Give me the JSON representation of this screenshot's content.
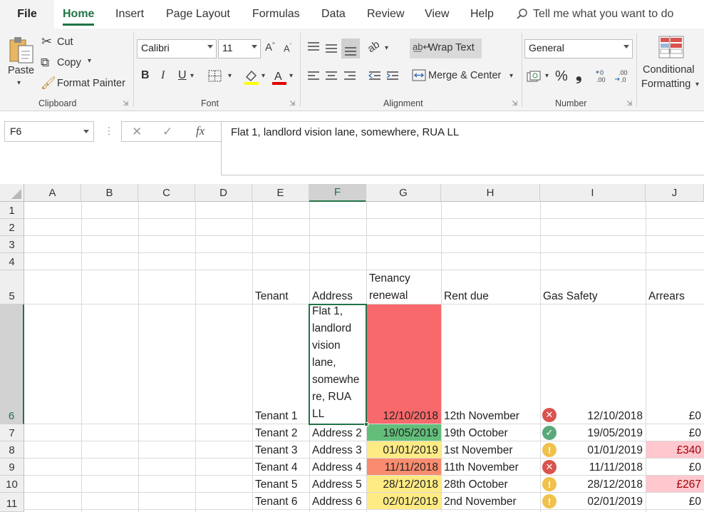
{
  "tabs": {
    "file": "File",
    "items": [
      "Home",
      "Insert",
      "Page Layout",
      "Formulas",
      "Data",
      "Review",
      "View",
      "Help"
    ],
    "tell_me": "Tell me what you want to do"
  },
  "ribbon": {
    "clipboard": {
      "paste": "Paste",
      "cut": "Cut",
      "copy": "Copy",
      "format_painter": "Format Painter",
      "label": "Clipboard"
    },
    "font": {
      "name": "Calibri",
      "size": "11",
      "bold": "B",
      "italic": "I",
      "underline": "U",
      "label": "Font"
    },
    "alignment": {
      "wrap_text": "Wrap Text",
      "merge_center": "Merge & Center",
      "label": "Alignment"
    },
    "number": {
      "format": "General",
      "percent": "%",
      "comma": "❟",
      "label": "Number"
    },
    "styles": {
      "conditional_line1": "Conditional",
      "conditional_line2": "Formatting"
    }
  },
  "formula_bar": {
    "name_box": "F6",
    "fx": "fx",
    "content": "Flat 1, landlord vision lane, somewhere, RUA LL"
  },
  "columns": [
    "A",
    "B",
    "C",
    "D",
    "E",
    "F",
    "G",
    "H",
    "I",
    "J"
  ],
  "rows": [
    "1",
    "2",
    "3",
    "4",
    "5",
    "6",
    "7",
    "8",
    "9",
    "10",
    "11"
  ],
  "headers": {
    "tenant": "Tenant",
    "address": "Address",
    "tenancy_line1": "Tenancy",
    "tenancy_line2": "renewal",
    "rent_due": "Rent due",
    "gas_safety": "Gas Safety",
    "arrears": "Arrears"
  },
  "colors": {
    "accent": "#217346",
    "red": "#f8696b",
    "green": "#63be7b",
    "yellow": "#ffeb84",
    "orange": "#f98c6f",
    "pink": "#ffc7ce",
    "pink_text": "#9c0006"
  },
  "table": [
    {
      "tenant": "Tenant 1",
      "address": "Flat 1, landlord vision lane, somewhe re, RUA LL",
      "renewal": "12/10/2018",
      "renewal_color": "#f8696b",
      "rent_due": "12th November",
      "gas_icon": "cross-icon",
      "gas_date": "12/10/2018",
      "arrears": "£0",
      "arrears_flag": false
    },
    {
      "tenant": "Tenant 2",
      "address": "Address 2",
      "renewal": "19/05/2019",
      "renewal_color": "#63be7b",
      "rent_due": "19th October",
      "gas_icon": "check-icon",
      "gas_date": "19/05/2019",
      "arrears": "£0",
      "arrears_flag": false
    },
    {
      "tenant": "Tenant 3",
      "address": "Address 3",
      "renewal": "01/01/2019",
      "renewal_color": "#ffeb84",
      "rent_due": "1st November",
      "gas_icon": "warning-icon",
      "gas_date": "01/01/2019",
      "arrears": "£340",
      "arrears_flag": true
    },
    {
      "tenant": "Tenant 4",
      "address": "Address 4",
      "renewal": "11/11/2018",
      "renewal_color": "#f98c6f",
      "rent_due": "11th November",
      "gas_icon": "cross-icon",
      "gas_date": "11/11/2018",
      "arrears": "£0",
      "arrears_flag": false
    },
    {
      "tenant": "Tenant 5",
      "address": "Address 5",
      "renewal": "28/12/2018",
      "renewal_color": "#ffeb84",
      "rent_due": "28th October",
      "gas_icon": "warning-icon",
      "gas_date": "28/12/2018",
      "arrears": "£267",
      "arrears_flag": true
    },
    {
      "tenant": "Tenant 6",
      "address": "Address 6",
      "renewal": "02/01/2019",
      "renewal_color": "#ffeb84",
      "rent_due": "2nd November",
      "gas_icon": "warning-icon",
      "gas_date": "02/01/2019",
      "arrears": "£0",
      "arrears_flag": false
    }
  ]
}
